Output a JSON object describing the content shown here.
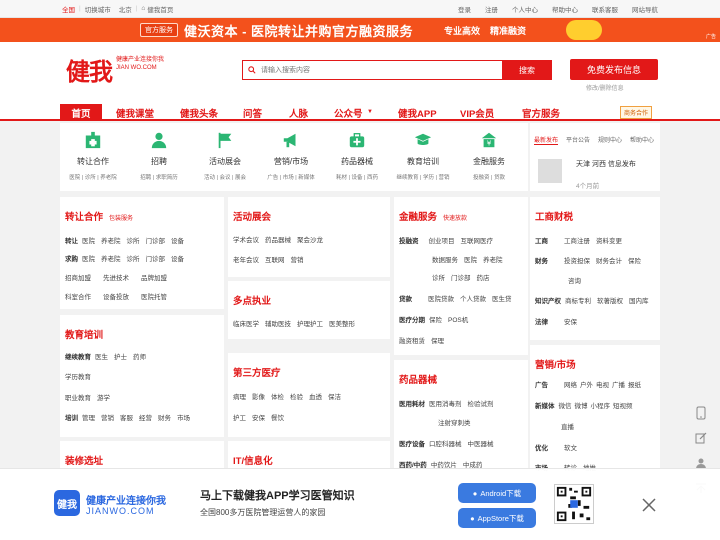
{
  "topbar": {
    "city": "全国",
    "switch_city": "切换城市",
    "current_city": "北京",
    "home_link": "健我首页",
    "links": [
      "登录",
      "注册",
      "个人中心",
      "帮助中心",
      "联系客服",
      "网站导航"
    ]
  },
  "banner": {
    "tag": "官方服务",
    "headline": "健沃资本 - 医院转让并购官方融资服务",
    "pill1": "专业高效",
    "pill2": "精准融资",
    "ad": "广告"
  },
  "header": {
    "logo_text": "健我",
    "logo_slogan": "健康产业连接你我",
    "logo_domain": "JIAN WO.COM",
    "search_placeholder": "请输入搜索内容",
    "search_button": "搜索",
    "publish_button": "免费发布信息",
    "publish_sub": "修改/删除信息"
  },
  "nav": {
    "items": [
      "首页",
      "健我课堂",
      "健我头条",
      "问答",
      "人脉",
      "公众号",
      "健我APP",
      "VIP会员",
      "官方服务"
    ],
    "biz": "商务合作"
  },
  "categories": [
    {
      "name": "转让合作",
      "sub": "医院 | 诊所 | 养老院"
    },
    {
      "name": "招聘",
      "sub": "招聘 | 求职简历"
    },
    {
      "name": "活动展会",
      "sub": "活动 | 会议 | 展会"
    },
    {
      "name": "营销/市场",
      "sub": "广告 | 市场 | 新媒体"
    },
    {
      "name": "药品器械",
      "sub": "耗材 | 设备 | 西药"
    },
    {
      "name": "教育培训",
      "sub": "继续教育 | 学历 | 营销"
    },
    {
      "name": "金融服务",
      "sub": "投融资 | 贷款"
    }
  ],
  "side": {
    "tabs": [
      "最新发布",
      "平台公告",
      "规则中心",
      "帮助中心"
    ],
    "post_title": "天津 河西 信息发布",
    "post_time": "4个月前"
  },
  "cards": {
    "transfer": {
      "title": "转让合作",
      "hint": "包装服务",
      "lines": [
        {
          "label": "转让",
          "items": [
            "医院",
            "养老院",
            "诊所",
            "门诊部",
            "设备"
          ]
        },
        {
          "label": "求购",
          "items": [
            "医院",
            "养老院",
            "诊所",
            "门诊部",
            "设备"
          ]
        },
        {
          "label": "",
          "items": [
            "招商加盟",
            "先进技术",
            "品牌加盟"
          ]
        },
        {
          "label": "",
          "items": [
            "科室合作",
            "设备投放",
            "医院托管"
          ]
        }
      ]
    },
    "event": {
      "title": "活动展会",
      "lines": [
        {
          "label": "",
          "items": [
            "学术会议",
            "药品器械",
            "聚会沙龙"
          ]
        },
        {
          "label": "",
          "items": [
            "老年会议",
            "互联网",
            "营销"
          ]
        }
      ]
    },
    "finance": {
      "title": "金融服务",
      "hint": "快速放款",
      "lines": [
        {
          "label": "投融资",
          "items": [
            "创业项目",
            "互联网医疗"
          ]
        },
        {
          "label": "",
          "items": [
            "数据服务",
            "医院",
            "养老院"
          ]
        },
        {
          "label": "",
          "items": [
            "诊所",
            "门诊部",
            "药店"
          ]
        },
        {
          "label": "贷款",
          "items": [
            "医院贷款",
            "个人贷款",
            "医生贷"
          ]
        },
        {
          "label": "医疗分期",
          "items": [
            "保险",
            "POS机"
          ]
        },
        {
          "label": "",
          "items": [
            "融资租赁",
            "保理"
          ]
        }
      ]
    },
    "business": {
      "title": "工商财税",
      "lines": [
        {
          "label": "工商",
          "items": [
            "工商注册",
            "资料变更"
          ]
        },
        {
          "label": "财务",
          "items": [
            "投资担保",
            "财务会计",
            "保险"
          ]
        },
        {
          "label": "",
          "items": [
            "咨询"
          ]
        },
        {
          "label": "知识产权",
          "items": [
            "商标专利",
            "软著版权",
            "国内库"
          ]
        },
        {
          "label": "法律",
          "items": [
            "安保"
          ]
        }
      ]
    },
    "practice": {
      "title": "多点执业",
      "lines": [
        {
          "label": "",
          "items": [
            "临床医学",
            "辅助医技",
            "护理护工",
            "医美整形"
          ]
        }
      ]
    },
    "thirdparty": {
      "title": "第三方医疗",
      "lines": [
        {
          "label": "",
          "items": [
            "病理",
            "影像",
            "体检",
            "检验",
            "血透",
            "保洁"
          ]
        },
        {
          "label": "",
          "items": [
            "护工",
            "安保",
            "餐饮"
          ]
        }
      ]
    },
    "education": {
      "title": "教育培训",
      "lines": [
        {
          "label": "继续教育",
          "items": [
            "医生",
            "护士",
            "药师"
          ]
        },
        {
          "label": "",
          "items": [
            "学历教育"
          ]
        },
        {
          "label": "",
          "items": [
            "职业教育",
            "游学"
          ]
        },
        {
          "label": "培训",
          "items": [
            "管理",
            "营销",
            "客服",
            "经营",
            "财务",
            "市场"
          ]
        }
      ]
    },
    "drugs": {
      "title": "药品器械",
      "lines": [
        {
          "label": "医用耗材",
          "items": [
            "医用消毒剂",
            "检验试剂"
          ]
        },
        {
          "label": "",
          "items": [
            "注射穿刺类"
          ]
        },
        {
          "label": "医疗设备",
          "items": [
            "口腔科器械",
            "中医器械"
          ]
        },
        {
          "label": "西药/中药",
          "items": [
            "中药饮片",
            "中成药"
          ]
        }
      ]
    },
    "marketing": {
      "title": "营销/市场",
      "lines": [
        {
          "label": "广告",
          "items": [
            "网络",
            "户外",
            "电视",
            "广播",
            "报纸"
          ]
        },
        {
          "label": "新媒体",
          "items": [
            "微信",
            "微博",
            "小程序",
            "短视频"
          ]
        },
        {
          "label": "",
          "items": [
            "直播"
          ]
        },
        {
          "label": "优化",
          "items": [
            "软文"
          ]
        },
        {
          "label": "市场",
          "items": [
            "转诊",
            "地推"
          ]
        }
      ]
    },
    "renovation": {
      "title": "装修选址"
    },
    "it": {
      "title": "IT/信息化"
    }
  },
  "app_bar": {
    "logo_text": "健我",
    "name": "健康产业连接你我",
    "url": "JIANWO.COM",
    "title": "马上下载健我APP学习医管知识",
    "subtitle": "全国800多万医院管理运营人的家园",
    "android": "Android下载",
    "appstore": "AppStore下载"
  },
  "colors": {
    "brand": "#e21818",
    "banner": "#f3511c",
    "app_blue": "#2b68e0"
  }
}
